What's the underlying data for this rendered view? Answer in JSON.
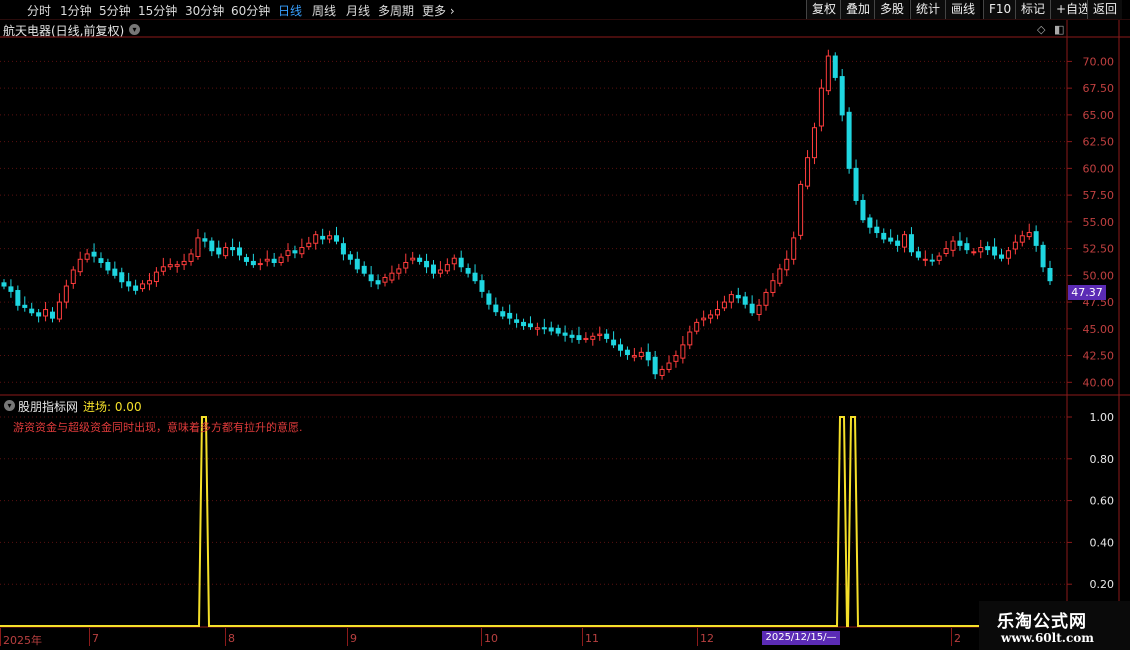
{
  "toolbar": {
    "periods": [
      "分时",
      "1分钟",
      "5分钟",
      "15分钟",
      "30分钟",
      "60分钟",
      "日线",
      "周线",
      "月线",
      "多周期",
      "更多"
    ],
    "active": "日线",
    "right_buttons": [
      "复权",
      "叠加",
      "多股",
      "统计",
      "画线",
      "F10",
      "标记",
      "+自选",
      "返回"
    ]
  },
  "chart_header": {
    "title": "航天电器(日线,前复权)"
  },
  "price_axis": {
    "ticks": [
      "70.00",
      "67.50",
      "65.00",
      "62.50",
      "60.00",
      "57.50",
      "55.00",
      "52.50",
      "50.00",
      "47.50",
      "45.00",
      "42.50",
      "40.00"
    ],
    "current_price": "47.37"
  },
  "indicator": {
    "name": "股朋指标网",
    "value_label": "进场: 0.00",
    "description": "游资资金与超级资金同时出现，意味着多方都有拉升的意愿.",
    "ticks": [
      "1.00",
      "0.80",
      "0.60",
      "0.40",
      "0.20"
    ]
  },
  "time_axis": {
    "labels": [
      "2025年",
      "7",
      "8",
      "9",
      "10",
      "11",
      "12",
      "1",
      "2"
    ],
    "cursor_date": "2025/12/15/—"
  },
  "watermark": {
    "line1": "乐淘公式网",
    "line2": "www.60lt.com"
  },
  "colors": {
    "up": "#ff3d3d",
    "down": "#1fd6e0",
    "signal": "#f5e02a",
    "grid": "#5a1010",
    "axis": "#8b1a1a"
  },
  "chart_data": {
    "type": "candlestick",
    "ylim": [
      39,
      72
    ],
    "closes": [
      49,
      48.5,
      47.2,
      47,
      46.5,
      46.2,
      46.8,
      46,
      47.5,
      49,
      50.5,
      51.5,
      52,
      51.8,
      51.2,
      50.5,
      50,
      49.4,
      49,
      48.6,
      49.2,
      49.5,
      50.3,
      50.8,
      51,
      51,
      51.3,
      52,
      53.5,
      53.2,
      52.3,
      52,
      52.6,
      52.4,
      51.9,
      51.3,
      51,
      51.1,
      51.5,
      51.2,
      51.7,
      52.3,
      52.1,
      52.6,
      53,
      53.8,
      53.4,
      53.7,
      53.2,
      52,
      51.5,
      50.6,
      50.2,
      49.5,
      49.2,
      49.8,
      50.2,
      50.6,
      51.2,
      51.6,
      51.3,
      50.8,
      50.2,
      50.5,
      51,
      51.6,
      50.8,
      50.2,
      49.5,
      48.5,
      47.3,
      46.6,
      46.2,
      46,
      45.6,
      45.3,
      45.2,
      45.1,
      45,
      44.8,
      44.6,
      44.4,
      44.2,
      44,
      44.1,
      44.3,
      44.5,
      44.1,
      43.5,
      43,
      42.6,
      42.5,
      42.8,
      42.1,
      40.8,
      41.2,
      41.8,
      42.5,
      43.5,
      44.7,
      45.6,
      46,
      46.3,
      46.8,
      47.5,
      48.2,
      47.9,
      47.3,
      46.5,
      47.2,
      48.4,
      49.5,
      50.6,
      51.5,
      53.5,
      58.5,
      61,
      63.8,
      67.5,
      70.5,
      68.5,
      65,
      60,
      57,
      55.2,
      54.5,
      54,
      53.4,
      53.2,
      52.8,
      53.8,
      52.2,
      51.7,
      51.5,
      51.4,
      51.8,
      52.5,
      53.2,
      52.8,
      52.4,
      52.2,
      52.6,
      52.4,
      51.9,
      51.6,
      52.3,
      53.1,
      53.7,
      54,
      52.8,
      50.8,
      49.5
    ],
    "signal_peaks": [
      {
        "date_index": "early 8",
        "value": 1.0
      },
      {
        "date_index": "2025/12/15",
        "value": 1.0
      },
      {
        "date_index": "after 2025/12/15",
        "value": 1.0
      }
    ]
  }
}
